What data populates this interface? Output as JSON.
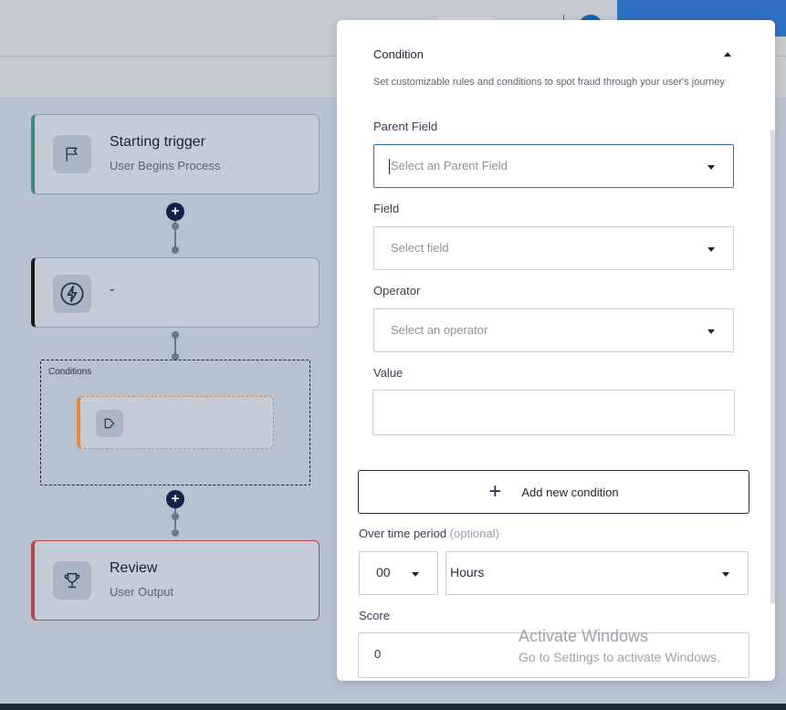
{
  "flow": {
    "start_node": {
      "title": "Starting trigger",
      "subtitle": "User Begins Process",
      "icon": "flag-icon"
    },
    "action_node": {
      "title": "-",
      "icon": "lightning-icon"
    },
    "conditions_group": {
      "label": "Conditions",
      "node_icon": "condition-icon"
    },
    "review_node": {
      "title": "Review",
      "subtitle": "User Output",
      "icon": "trophy-icon"
    }
  },
  "panel": {
    "section_title": "Condition",
    "description": "Set customizable rules and conditions to spot fraud through your user's journey",
    "parent_field": {
      "label": "Parent Field",
      "placeholder": "Select an Parent Field"
    },
    "field": {
      "label": "Field",
      "placeholder": "Select field"
    },
    "operator": {
      "label": "Operator",
      "placeholder": "Select an operator"
    },
    "value": {
      "label": "Value",
      "value": ""
    },
    "add_condition_label": "Add new condition",
    "time_period": {
      "label": "Over time period",
      "optional": "(optional)",
      "amount": "00",
      "unit": "Hours"
    },
    "score": {
      "label": "Score",
      "value": "0"
    }
  },
  "watermark": {
    "line1": "Activate Windows",
    "line2": "Go to Settings to activate Windows."
  },
  "colors": {
    "accent_blue": "#2f6fc4",
    "start_accent": "#3f8a80",
    "review_accent": "#b0494c",
    "condition_accent": "#e08a4a",
    "plus_dot": "#17204a"
  }
}
